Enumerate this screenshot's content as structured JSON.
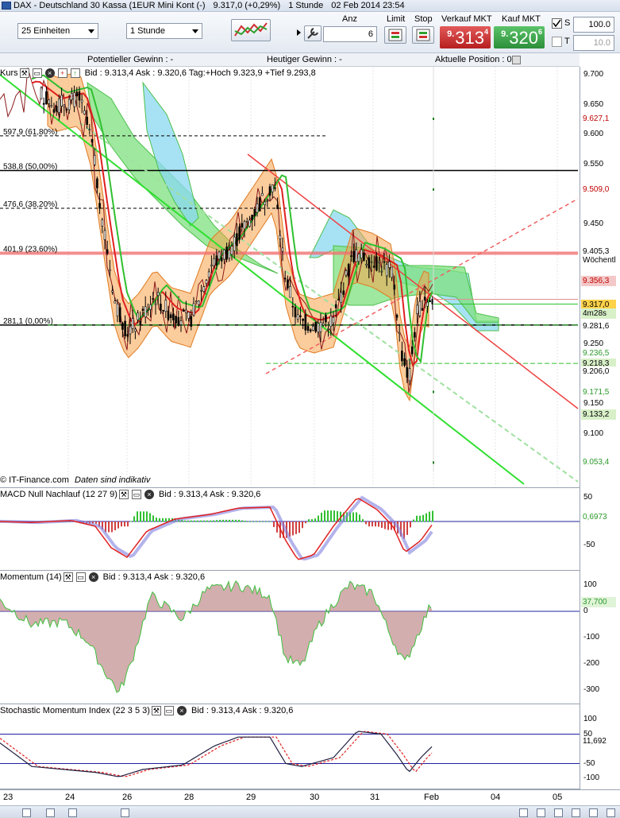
{
  "window": {
    "symbol": "DAX - Deutschland 30 Kassa (1EUR Mini Kont (-)",
    "last": "9.317,0 (+0,29%)",
    "interval": "1 Stunde",
    "datetime": "02 Feb 2014 23:54"
  },
  "toolbar": {
    "units_select": "25 Einheiten",
    "period_select": "1 Stunde",
    "anz_label": "Anz",
    "anz_value": "6",
    "limit_label": "Limit",
    "stop_label": "Stop",
    "sell_label": "Verkauf MKT",
    "buy_label": "Kauf MKT",
    "sell_small": "9.",
    "sell_big": "313",
    "sell_sup": "4",
    "buy_small": "9.",
    "buy_big": "320",
    "buy_sup": "6",
    "s_label": "S",
    "t_label": "T",
    "s_value": "100.0",
    "t_value": "10.0"
  },
  "infobar": {
    "potential": "Potentieller Gewinn : -",
    "today": "Heutiger Gewinn : -",
    "position": "Aktuelle Position : 0"
  },
  "main": {
    "title": "Kurs",
    "header": "Bid : 9.313,4 Ask : 9.320,6 Tag:+Hoch 9.323,9 +Tief 9.293,8",
    "credit_source": "© IT-Finance.com",
    "credit_note": "Daten sind indikativ",
    "fib_labels": [
      "597,9 (61,80%)",
      "538,8 (50,00%)",
      "476,6 (38,20%)",
      "401,9 (23,60%)",
      "281,1 (0,00%)"
    ],
    "axis_ticks": [
      "9.700",
      "9.650",
      "9.600",
      "9.550",
      "9.450",
      "9.250",
      "9.150",
      "9.100"
    ],
    "tags": [
      {
        "text": "9.627,1",
        "color": "#c00000",
        "bg": "#ffffff"
      },
      {
        "text": "9.509,0",
        "color": "#c00000",
        "bg": "#ffffff"
      },
      {
        "text": "9.405,3",
        "color": "#000000",
        "bg": "#ffffff"
      },
      {
        "text": "Wöchentli",
        "color": "#000000",
        "bg": "#ffffff"
      },
      {
        "text": "9.356,3",
        "color": "#c00000",
        "bg": "#f4c8c8"
      },
      {
        "text": "9.317,0",
        "color": "#000000",
        "bg": "#ffd24a"
      },
      {
        "text": "4m28s",
        "color": "#000000",
        "bg": "#d8f0c8"
      },
      {
        "text": "9.281,6",
        "color": "#000000",
        "bg": "#ffffff"
      },
      {
        "text": "9.236,5",
        "color": "#2a9a2a",
        "bg": "#ffffff"
      },
      {
        "text": "9.218,3",
        "color": "#000000",
        "bg": "#d8f0c8"
      },
      {
        "text": "9.206,0",
        "color": "#000000",
        "bg": "#ffffff"
      },
      {
        "text": "9.171,5",
        "color": "#2a9a2a",
        "bg": "#ffffff"
      },
      {
        "text": "9.133,2",
        "color": "#000000",
        "bg": "#d8f0c8"
      },
      {
        "text": "9.053,4",
        "color": "#2a9a2a",
        "bg": "#ffffff"
      }
    ]
  },
  "macd": {
    "title": "MACD Null Nachlauf (12 27 9)",
    "header": "Bid : 9.313,4 Ask : 9.320,6",
    "ticks": [
      "50",
      "-50"
    ],
    "value": "0,6973"
  },
  "momentum": {
    "title": "Momentum (14)",
    "header": "Bid : 9.313,4 Ask : 9.320,6",
    "ticks": [
      "100",
      "0",
      "-100",
      "-200",
      "-300"
    ],
    "value": "37,700"
  },
  "stochastic": {
    "title": "Stochastic Momentum Index (22 3 5 3)",
    "header": "Bid : 9.313,4 Ask : 9.320,6",
    "ticks": [
      "100",
      "50",
      "-50",
      "-100"
    ],
    "value": "11,692"
  },
  "xaxis": [
    "23",
    "24",
    "26",
    "28",
    "29",
    "30",
    "31",
    "Feb",
    "04",
    "05"
  ],
  "colors": {
    "up": "#2fd62f",
    "down": "#e03030",
    "cloud_green": "#7fe07f",
    "cloud_cyan": "#8ad8f0",
    "band_orange": "#f7a34a"
  }
}
